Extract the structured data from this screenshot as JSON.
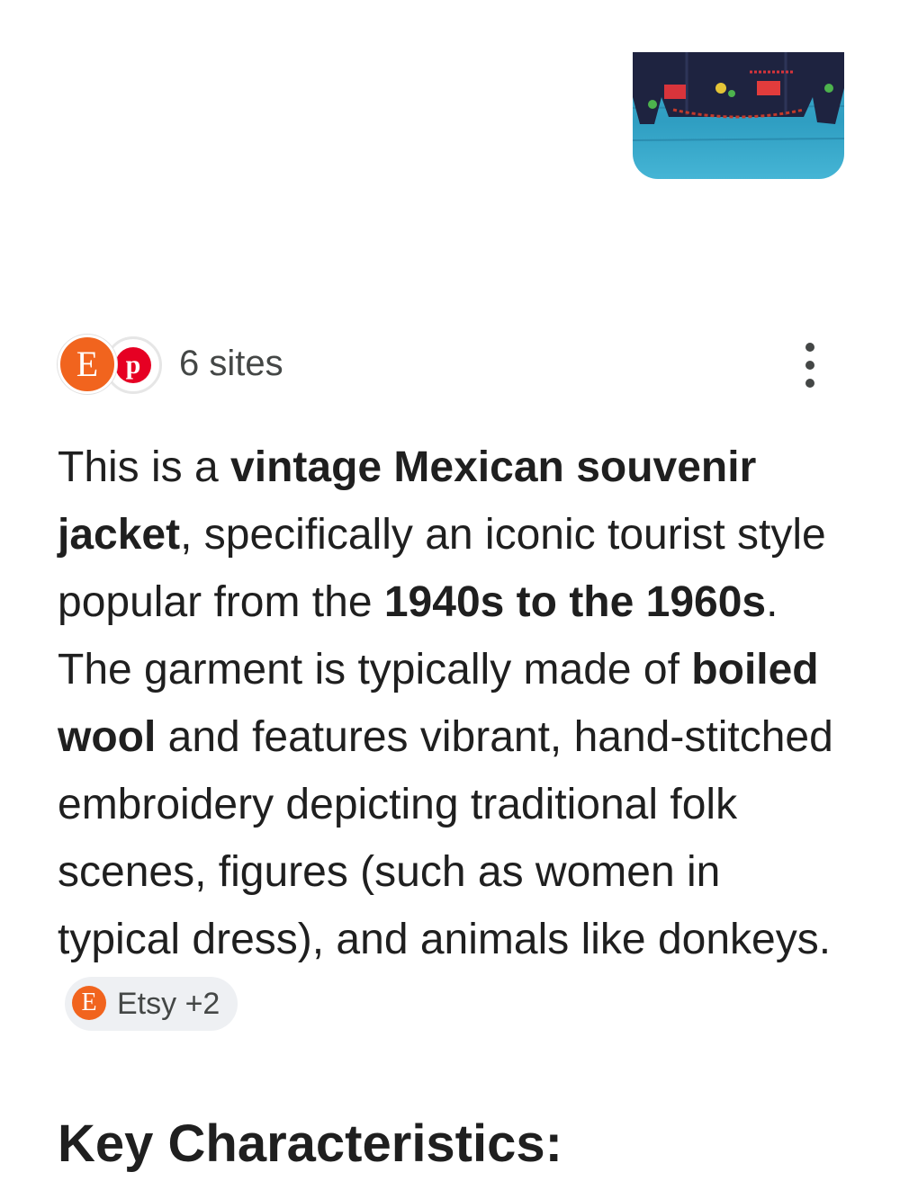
{
  "image": {
    "alt": ""
  },
  "sources": {
    "icons": [
      "etsy-logo-icon",
      "pinterest-logo-icon"
    ],
    "etsy_glyph": "E",
    "pinterest_glyph": "p",
    "count_label": "6 sites"
  },
  "answer": {
    "t1": "This is a ",
    "b1": "vintage Mexican souvenir jacket",
    "t2": ", specifically an iconic tourist style popular from the ",
    "b2": "1940s to the 1960s",
    "t3": ". The garment is typically made of ",
    "b3": "boiled wool",
    "t4": " and features vibrant, hand-stitched embroidery depicting traditional folk scenes, figures (such as women in typical dress), and animals like donkeys.",
    "citation": {
      "logo_glyph": "E",
      "label": "Etsy +2"
    }
  },
  "section": {
    "heading": "Key Characteristics:"
  },
  "colors": {
    "etsy": "#f1641e",
    "pinterest": "#e60023",
    "chip_bg": "#eef0f3",
    "text": "#1f1f1f"
  }
}
